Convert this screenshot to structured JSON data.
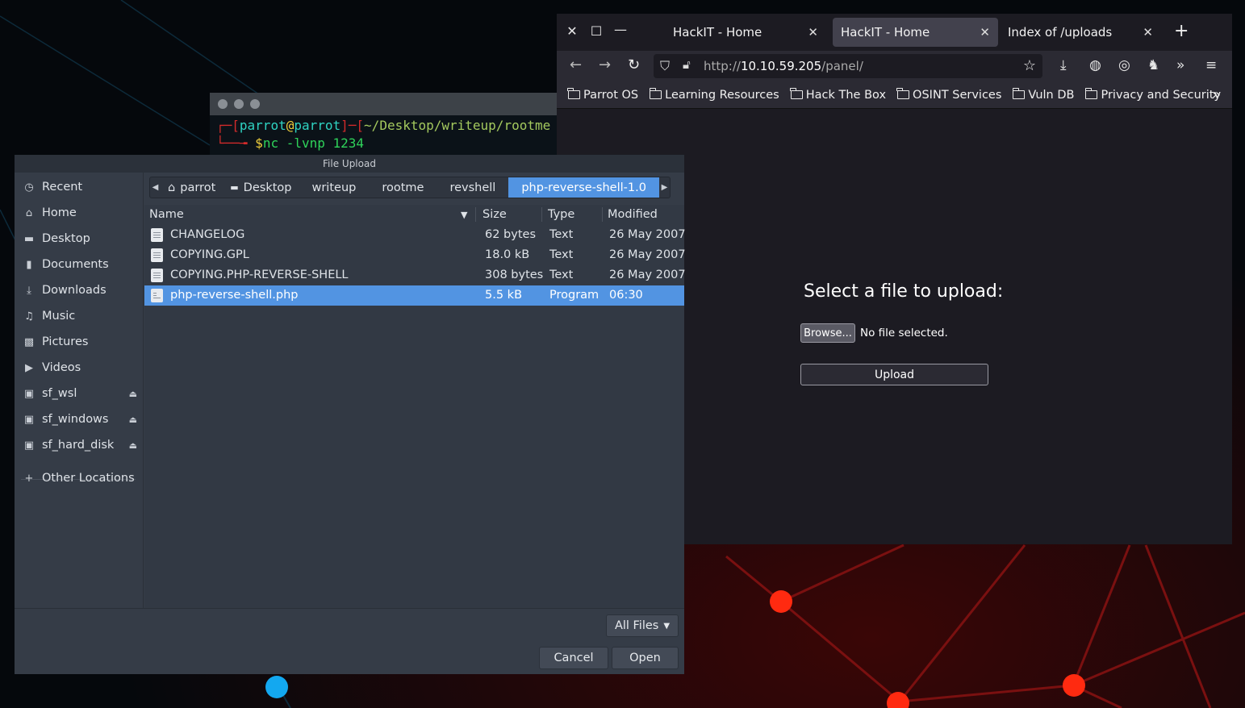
{
  "terminal": {
    "user": "parrot",
    "at": "@",
    "host": "parrot",
    "path": "~/Desktop/writeup/rootme",
    "prompt": "$",
    "command": "nc -lvnp 1234"
  },
  "browser": {
    "tabs": [
      {
        "title": "HackIT - Home",
        "active": false
      },
      {
        "title": "HackIT - Home",
        "active": true
      },
      {
        "title": "Index of /uploads",
        "active": false
      }
    ],
    "url": {
      "scheme": "http://",
      "host": "10.10.59.205",
      "path": "/panel/"
    },
    "bookmarks": [
      "Parrot OS",
      "Learning Resources",
      "Hack The Box",
      "OSINT Services",
      "Vuln DB",
      "Privacy and Security"
    ],
    "page": {
      "heading": "Select a file to upload:",
      "browse_label": "Browse...",
      "no_file_text": "No file selected.",
      "upload_label": "Upload"
    }
  },
  "dialog": {
    "title": "File Upload",
    "places": [
      {
        "label": "Recent",
        "icon": "clock-icon"
      },
      {
        "label": "Home",
        "icon": "home-icon"
      },
      {
        "label": "Desktop",
        "icon": "desktop-icon"
      },
      {
        "label": "Documents",
        "icon": "document-icon"
      },
      {
        "label": "Downloads",
        "icon": "download-icon"
      },
      {
        "label": "Music",
        "icon": "music-icon"
      },
      {
        "label": "Pictures",
        "icon": "picture-icon"
      },
      {
        "label": "Videos",
        "icon": "video-icon"
      },
      {
        "label": "sf_wsl",
        "icon": "drive-icon"
      },
      {
        "label": "sf_windows",
        "icon": "drive-icon"
      },
      {
        "label": "sf_hard_disk",
        "icon": "drive-icon"
      },
      {
        "label": "Other Locations",
        "icon": "plus-icon"
      }
    ],
    "path": [
      "parrot",
      "Desktop",
      "writeup",
      "rootme",
      "revshell",
      "php-reverse-shell-1.0"
    ],
    "columns": {
      "name": "Name",
      "size": "Size",
      "type": "Type",
      "modified": "Modified"
    },
    "files": [
      {
        "name": "CHANGELOG",
        "size": "62 bytes",
        "type": "Text",
        "modified": "26 May 2007"
      },
      {
        "name": "COPYING.GPL",
        "size": "18.0 kB",
        "type": "Text",
        "modified": "26 May 2007"
      },
      {
        "name": "COPYING.PHP-REVERSE-SHELL",
        "size": "308 bytes",
        "type": "Text",
        "modified": "26 May 2007"
      },
      {
        "name": "php-reverse-shell.php",
        "size": "5.5 kB",
        "type": "Program",
        "modified": "06:30"
      }
    ],
    "filter_label": "All Files",
    "cancel_label": "Cancel",
    "open_label": "Open"
  },
  "colors": {
    "selection": "#5294e2",
    "desktop_node_red": "#ff2a10",
    "desktop_node_blue": "#13a8f0"
  }
}
